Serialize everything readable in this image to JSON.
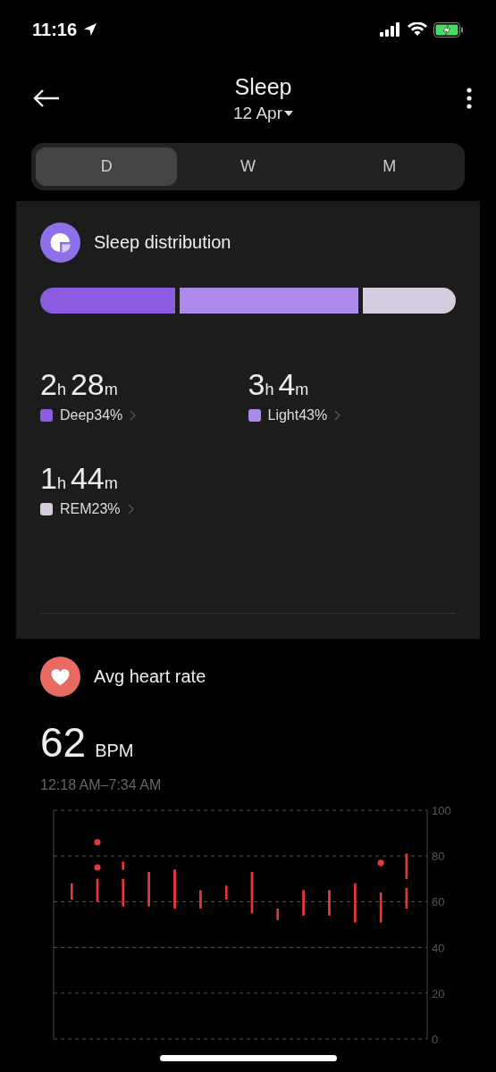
{
  "status_bar": {
    "time": "11:16"
  },
  "header": {
    "title": "Sleep",
    "date": "12 Apr"
  },
  "tabs": [
    {
      "label": "D",
      "selected": true
    },
    {
      "label": "W",
      "selected": false
    },
    {
      "label": "M",
      "selected": false
    }
  ],
  "sleep_distribution": {
    "title": "Sleep distribution",
    "stages": [
      {
        "duration_parts": [
          "2",
          "h",
          "28",
          "m"
        ],
        "label": "Deep34%",
        "color": "#8b5ce0"
      },
      {
        "duration_parts": [
          "3",
          "h",
          "4",
          "m"
        ],
        "label": "Light43%",
        "color": "#ab8aea"
      },
      {
        "duration_parts": [
          "1",
          "h",
          "44",
          "m"
        ],
        "label": "REM23%",
        "color": "#d6cce0"
      }
    ]
  },
  "heart_rate": {
    "title": "Avg heart rate",
    "value": "62",
    "unit": "BPM",
    "time_range": "12:18 AM–7:34 AM",
    "chart_data": {
      "type": "candlestick",
      "grid": true,
      "ylim": [
        0,
        100
      ],
      "yticks": [
        0,
        20,
        40,
        60,
        80,
        100
      ],
      "series": [
        {
          "color": "#e5383b",
          "ohlc": [
            [
              61,
              68,
              61,
              68
            ],
            [
              60,
              70,
              60,
              70
            ],
            [
              58,
              70,
              58,
              70
            ],
            [
              58,
              73,
              58,
              73
            ],
            [
              57,
              74,
              57,
              74
            ],
            [
              57,
              65,
              57,
              65
            ],
            [
              61,
              67,
              61,
              67
            ],
            [
              55,
              73,
              55,
              73
            ],
            [
              52,
              57,
              52,
              57
            ],
            [
              54,
              65,
              54,
              65
            ],
            [
              54,
              65,
              54,
              65
            ],
            [
              51,
              68,
              51,
              68
            ],
            [
              51,
              64,
              51,
              64
            ],
            [
              57,
              66,
              57,
              66
            ]
          ]
        },
        {
          "color": "#e5383b",
          "ohlc": [
            null,
            null,
            [
              74,
              77.5,
              74,
              77.5
            ],
            null,
            null,
            null,
            null,
            null,
            null,
            null,
            null,
            null,
            null,
            [
              70,
              81,
              70,
              81
            ]
          ]
        },
        {
          "color": "#e5383b",
          "ohlc": [
            null,
            [
              84.6,
              87.4,
              84.6,
              87.4
            ],
            null,
            null,
            null,
            null,
            null,
            null,
            null,
            null,
            null,
            null,
            null,
            null
          ]
        },
        {
          "color": "#e5383b",
          "ohlc": [
            null,
            [
              73.6,
              76.4,
              73.6,
              76.4
            ],
            null,
            null,
            null,
            null,
            null,
            null,
            null,
            null,
            null,
            null,
            [
              75.6,
              78.4,
              75.6,
              78.4
            ],
            null
          ]
        }
      ]
    }
  }
}
